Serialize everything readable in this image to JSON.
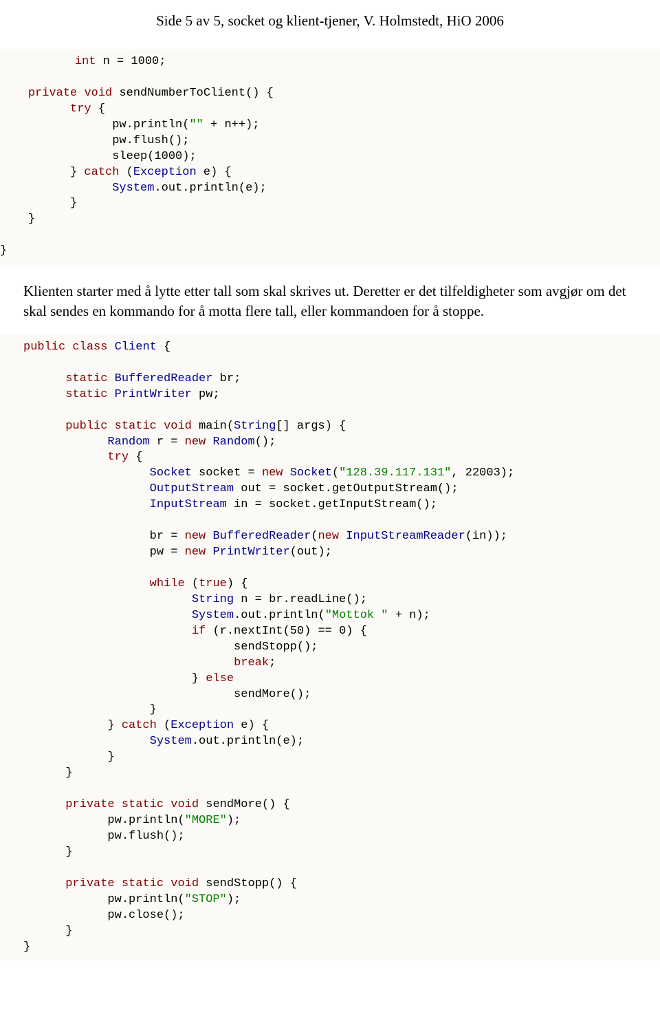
{
  "header": "Side 5 av 5, socket og klient-tjener, V. Holmstedt, HiO 2006",
  "code1": {
    "l1a": "    ",
    "l1_kw1": "int",
    "l1b": " n = 1000;",
    "l3a": "    ",
    "l3_kw1": "private",
    "l3b": " ",
    "l3_kw2": "void",
    "l3c": " sendNumberToClient() {",
    "l4a": "          ",
    "l4_kw1": "try",
    "l4b": " {",
    "l5a": "                pw.println(",
    "l5_str": "\"\"",
    "l5b": " + n++);",
    "l6": "                pw.flush();",
    "l7": "                sleep(1000);",
    "l8a": "          } ",
    "l8_kw1": "catch",
    "l8b": " (",
    "l8_cls1": "Exception",
    "l8c": " e) {",
    "l9a": "                ",
    "l9_cls1": "System",
    "l9b": ".out.println(e);",
    "l10": "          }",
    "l11": "    }",
    "l13": "}"
  },
  "para1": "Klienten starter med å lytte etter tall som skal skrives ut. Deretter er det tilfeldigheter som avgjør om det skal sendes en kommando for å motta flere tall, eller kommandoen for å stoppe.",
  "code2": {
    "l1_kw1": "public",
    "l1a": " ",
    "l1_kw2": "class",
    "l1b": " ",
    "l1_cls1": "Client",
    "l1c": " {",
    "l3a": "      ",
    "l3_kw1": "static",
    "l3b": " ",
    "l3_cls1": "BufferedReader",
    "l3c": " br;",
    "l4a": "      ",
    "l4_kw1": "static",
    "l4b": " ",
    "l4_cls1": "PrintWriter",
    "l4c": " pw;",
    "l6a": "      ",
    "l6_kw1": "public",
    "l6b": " ",
    "l6_kw2": "static",
    "l6c": " ",
    "l6_kw3": "void",
    "l6d": " main(",
    "l6_cls1": "String",
    "l6e": "[] args) {",
    "l7a": "            ",
    "l7_cls1": "Random",
    "l7b": " r = ",
    "l7_kw1": "new",
    "l7c": " ",
    "l7_cls2": "Random",
    "l7d": "();",
    "l8a": "            ",
    "l8_kw1": "try",
    "l8b": " {",
    "l9a": "                  ",
    "l9_cls1": "Socket",
    "l9b": " socket = ",
    "l9_kw1": "new",
    "l9c": " ",
    "l9_cls2": "Socket",
    "l9d": "(",
    "l9_str": "\"128.39.117.131\"",
    "l9e": ", 22003);",
    "l10a": "                  ",
    "l10_cls1": "OutputStream",
    "l10b": " out = socket.getOutputStream();",
    "l11a": "                  ",
    "l11_cls1": "InputStream",
    "l11b": " in = socket.getInputStream();",
    "l13a": "                  br = ",
    "l13_kw1": "new",
    "l13b": " ",
    "l13_cls1": "BufferedReader",
    "l13c": "(",
    "l13_kw2": "new",
    "l13d": " ",
    "l13_cls2": "InputStreamReader",
    "l13e": "(in));",
    "l14a": "                  pw = ",
    "l14_kw1": "new",
    "l14b": " ",
    "l14_cls1": "PrintWriter",
    "l14c": "(out);",
    "l16a": "                  ",
    "l16_kw1": "while",
    "l16b": " (",
    "l16_kw2": "true",
    "l16c": ") {",
    "l17a": "                        ",
    "l17_cls1": "String",
    "l17b": " n = br.readLine();",
    "l18a": "                        ",
    "l18_cls1": "System",
    "l18b": ".out.println(",
    "l18_str": "\"Mottok \"",
    "l18c": " + n);",
    "l19a": "                        ",
    "l19_kw1": "if",
    "l19b": " (r.nextInt(50) == 0) {",
    "l20": "                              sendStopp();",
    "l21a": "                              ",
    "l21_kw1": "break",
    "l21b": ";",
    "l22a": "                        } ",
    "l22_kw1": "else",
    "l23": "                              sendMore();",
    "l24": "                  }",
    "l25a": "            } ",
    "l25_kw1": "catch",
    "l25b": " (",
    "l25_cls1": "Exception",
    "l25c": " e) {",
    "l26a": "                  ",
    "l26_cls1": "System",
    "l26b": ".out.println(e);",
    "l27": "            }",
    "l28": "      }",
    "l30a": "      ",
    "l30_kw1": "private",
    "l30b": " ",
    "l30_kw2": "static",
    "l30c": " ",
    "l30_kw3": "void",
    "l30d": " sendMore() {",
    "l31a": "            pw.println(",
    "l31_str": "\"MORE\"",
    "l31b": ");",
    "l32": "            pw.flush();",
    "l33": "      }",
    "l35a": "      ",
    "l35_kw1": "private",
    "l35b": " ",
    "l35_kw2": "static",
    "l35c": " ",
    "l35_kw3": "void",
    "l35d": " sendStopp() {",
    "l36a": "            pw.println(",
    "l36_str": "\"STOP\"",
    "l36b": ");",
    "l37": "            pw.close();",
    "l38": "      }",
    "l39": "}"
  }
}
